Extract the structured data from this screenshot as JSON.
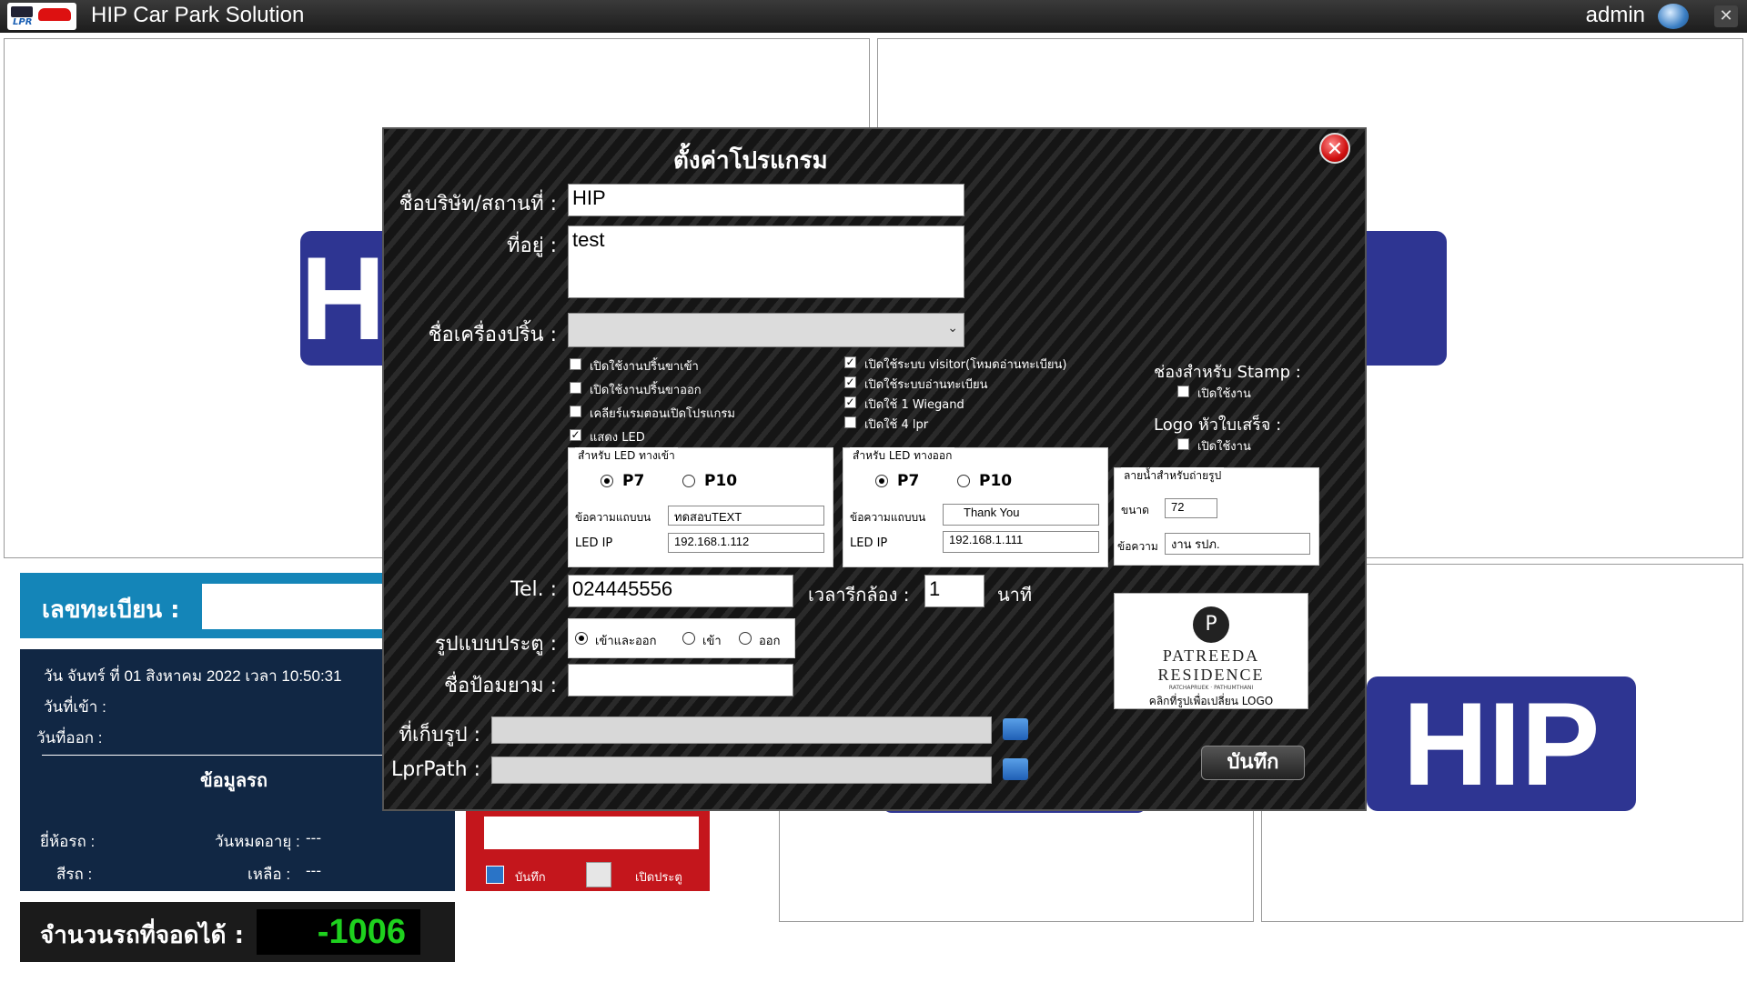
{
  "app": {
    "title": "HIP Car Park Solution",
    "user": "admin",
    "logo_text": "LPR"
  },
  "background": {
    "hip_text": "HIP",
    "plate_label": "เลขทะเบียน :",
    "date_line": "วัน จันทร์ ที่ 01 สิงหาคม 2022  เวลา  10:50:31",
    "date_in_label": "วันที่เข้า :",
    "date_out_label": "วันที่ออก :",
    "car_info_title": "ข้อมูลรถ",
    "brand_label": "ยี่ห้อรถ :",
    "expire_label": "วันหมดอายุ :",
    "expire_value": "---",
    "color_label": "สีรถ :",
    "remain_label": "เหลือ :",
    "remain_value": "---",
    "count_label": "จำนวนรถที่จอดได้ :",
    "count_value": "-1006",
    "save_label": "บันทึก",
    "open_gate_label": "เปิดประตู"
  },
  "modal": {
    "title": "ตั้งค่าโปรแกรม",
    "company_label": "ชื่อบริษัท/สถานที่ :",
    "company_value": "HIP",
    "address_label": "ที่อยู่ :",
    "address_value": "test",
    "printer_label": "ชื่อเครื่องปริ้น :",
    "printer_value": "",
    "checkboxes_left": [
      {
        "label": "เปิดใช้งานปริ้นขาเข้า",
        "checked": false
      },
      {
        "label": "เปิดใช้งานปริ้นขาออก",
        "checked": false
      },
      {
        "label": "เคลียร์แรมตอนเปิดโปรแกรม",
        "checked": false
      },
      {
        "label": "แสดง LED",
        "checked": true
      }
    ],
    "checkboxes_mid": [
      {
        "label": "เปิดใช้ระบบ visitor(โหมดอ่านทะเบียน)",
        "checked": true
      },
      {
        "label": "เปิดใช้ระบบอ่านทะเบียน",
        "checked": true
      },
      {
        "label": "เปิดใช้ 1 Wiegand",
        "checked": true
      },
      {
        "label": "เปิดใช้ 4 lpr",
        "checked": false
      }
    ],
    "stamp_label": "ช่องสำหรับ Stamp :",
    "stamp_enable": "เปิดใช้งาน",
    "receipt_logo_label": "Logo หัวใบเสร็จ :",
    "receipt_logo_enable": "เปิดใช้งาน",
    "led_in": {
      "legend": "สำหรับ LED ทางเข้า",
      "p7": "P7",
      "p10": "P10",
      "text_label": "ข้อความแถบบน",
      "text_value": "ทดสอบTEXT",
      "ip_label": "LED IP",
      "ip_value": "192.168.1.112"
    },
    "led_out": {
      "legend": "สำหรับ LED ทางออก",
      "p7": "P7",
      "p10": "P10",
      "text_label": "ข้อความแถบบน",
      "text_value": "Thank You",
      "ip_label": "LED IP",
      "ip_value": "192.168.1.111"
    },
    "watermark": {
      "legend": "ลายน้ำสำหรับถ่ายรูป",
      "size_label": "ขนาด",
      "size_value": "72",
      "text_label": "ข้อความ",
      "text_value": "งาน รปภ."
    },
    "tel_label": "Tel.  :",
    "tel_value": "024445556",
    "camera_time_label": "เวลารีกล้อง  :",
    "camera_time_value": "1",
    "camera_time_unit": "นาที",
    "gate_label": "รูปแบบประตู :",
    "gate_options": [
      "เข้าและออก",
      "เข้า",
      "ออก"
    ],
    "guard_label": "ชื่อป้อมยาม :",
    "guard_value": "",
    "image_path_label": "ที่เก็บรูป :",
    "lpr_path_label": "LprPath :",
    "logo_brand": "PATREEDA",
    "logo_brand2": "RESIDENCE",
    "logo_sub": "RATCHAPRUEK · PATHUMTHANI",
    "logo_hint": "คลิกที่รูปเพื่อเปลี่ยน LOGO",
    "save_label": "บันทึก"
  }
}
